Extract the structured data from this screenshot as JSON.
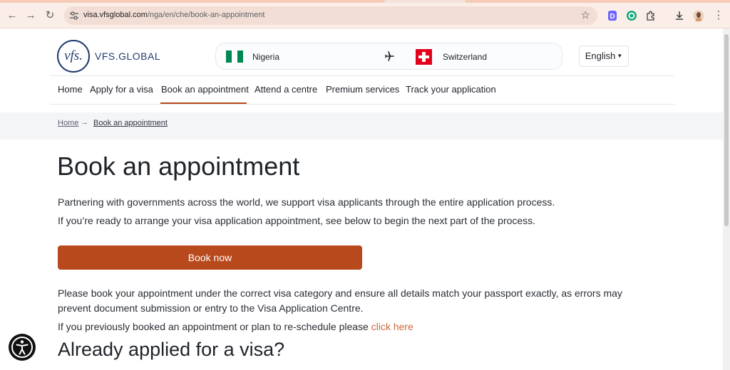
{
  "browser": {
    "url_host": "visa.vfsglobal.com",
    "url_path": "/nga/en/che/book-an-appointment"
  },
  "header": {
    "logo_text": "vfs.",
    "brand": "VFS.GLOBAL",
    "from_country": "Nigeria",
    "to_country": "Switzerland",
    "language": "English"
  },
  "nav": {
    "items": [
      {
        "label": "Home"
      },
      {
        "label": "Apply for a visa"
      },
      {
        "label": "Book an appointment"
      },
      {
        "label": "Attend a centre"
      },
      {
        "label": "Premium services"
      },
      {
        "label": "Track your application"
      }
    ],
    "active": "Book an appointment"
  },
  "breadcrumb": {
    "home": "Home",
    "arrow": "→",
    "current": "Book an appointment"
  },
  "main": {
    "title": "Book an appointment",
    "intro1": "Partnering with governments across the world, we support visa applicants through the entire application process.",
    "intro2": "If you’re ready to arrange your visa application appointment, see below to begin the next part of the process.",
    "book_button": "Book now",
    "notice": "Please book your appointment under the correct visa category and ensure all details match your passport exactly, as errors may prevent document submission or entry to the Visa Application Centre.",
    "reschedule_text": "If you previously booked an appointment or plan to re-schedule please ",
    "reschedule_link": "click here",
    "subtitle": "Already applied for a visa?"
  },
  "colors": {
    "accent": "#b8491c",
    "brand_navy": "#1e3a6e",
    "link": "#c86a3a"
  }
}
